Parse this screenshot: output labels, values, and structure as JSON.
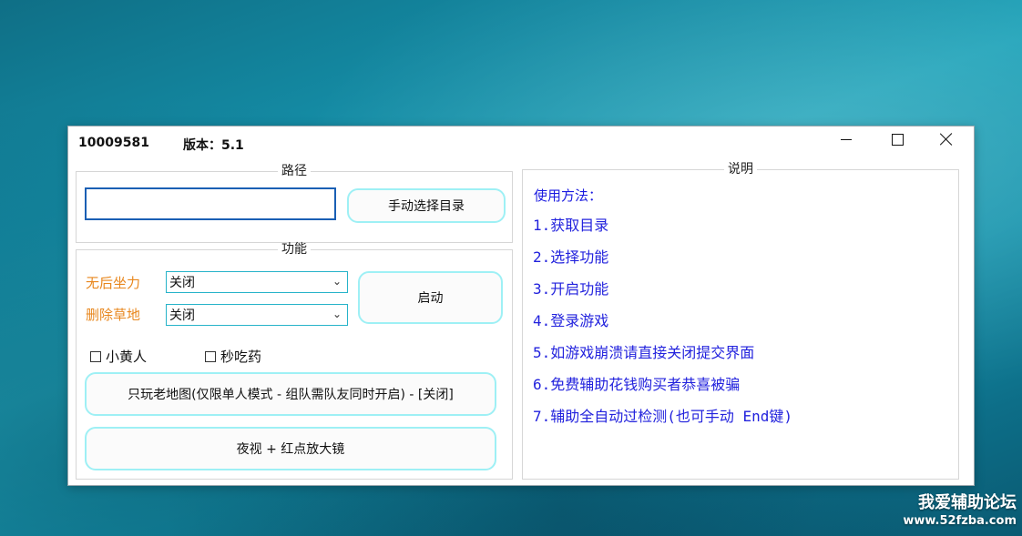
{
  "window": {
    "id_text": "10009581",
    "version_text": "版本：5.1"
  },
  "path_group": {
    "legend": "路径",
    "input_value": "",
    "choose_button": "手动选择目录"
  },
  "function_group": {
    "legend": "功能",
    "recoil_label": "无后坐力",
    "recoil_value": "关闭",
    "grass_label": "删除草地",
    "grass_value": "关闭",
    "start_button": "启动",
    "checkbox_yellow": "小黄人",
    "checkbox_pill": "秒吃药",
    "oldmap_button": "只玩老地图(仅限单人模式 - 组队需队友同时开启) - [关闭]",
    "night_button": "夜视 + 红点放大镜"
  },
  "description": {
    "legend": "说明",
    "title": "使用方法：",
    "steps": [
      "1.获取目录",
      "2.选择功能",
      "3.开启功能",
      "4.登录游戏",
      "5.如游戏崩溃请直接关闭提交界面",
      "6.免费辅助花钱购买者恭喜被骗",
      "7.辅助全自动过检测(也可手动 End键)"
    ]
  },
  "watermark": {
    "title": "我爱辅助论坛",
    "url": "www.52fzba.com"
  },
  "colors": {
    "accent_border": "#9ef0f5",
    "option_label": "#e8871e",
    "desc_text": "#2222dd",
    "input_border": "#1a5fb4"
  }
}
